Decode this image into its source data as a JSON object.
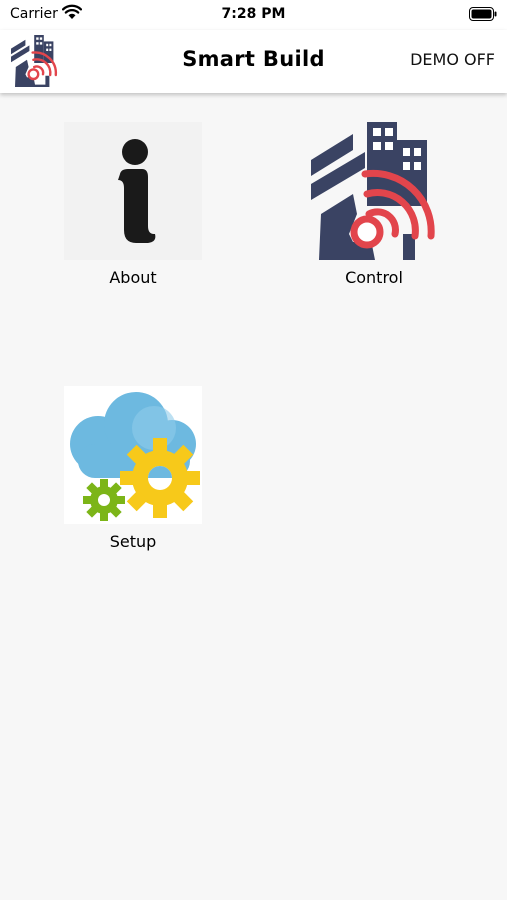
{
  "status_bar": {
    "carrier": "Carrier",
    "time": "7:28 PM"
  },
  "nav": {
    "title": "Smart Build",
    "demo_label": "DEMO OFF"
  },
  "tiles": [
    {
      "label": "About",
      "icon": "info-icon"
    },
    {
      "label": "Control",
      "icon": "smart-building-icon"
    },
    {
      "label": "Setup",
      "icon": "cloud-gears-icon"
    }
  ],
  "colors": {
    "navy": "#3a4363",
    "red": "#e2454c",
    "cloud": "#6db9e0",
    "gear_yellow": "#f7c91a",
    "gear_green": "#7cb518"
  }
}
